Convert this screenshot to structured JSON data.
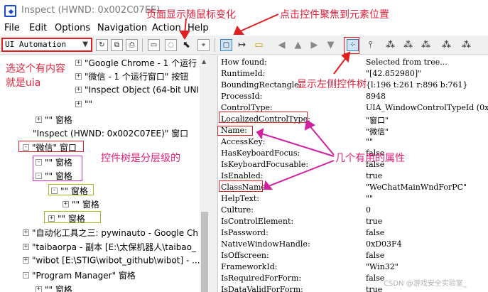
{
  "window": {
    "title": "Inspect  (HWND: 0x002C07EE)"
  },
  "menu": [
    "File",
    "Edit",
    "Options",
    "Navigation",
    "Action",
    "Help"
  ],
  "toolbar": {
    "mode_value": "UI Automation",
    "icons": [
      "refresh-icon",
      "copy-icon",
      "print-icon",
      "highlight-rect-icon",
      "cursor-watch-icon",
      "focus-watch-icon",
      "show-highlight-icon",
      "separator",
      "yellow-rect-icon",
      "nav-left-icon",
      "nav-up-icon",
      "nav-right-icon",
      "nav-down-icon",
      "nav-first-child-icon",
      "tree-view-icon",
      "tree-parent-icon",
      "tree-child-icon",
      "tree-sibling-icon",
      "tree-next-icon",
      "tree-last-icon"
    ]
  },
  "tree": {
    "rows": [
      {
        "label": "\"Google Chrome - 1 个运行",
        "expander": "+"
      },
      {
        "label": "\"微信 - 1 个运行窗口\" 按钮",
        "expander": "+"
      },
      {
        "label": "\"Inspect Object (64-bit UNI",
        "expander": "+"
      },
      {
        "label": "\"\"",
        "expander": "+"
      },
      {
        "label": "\"\" 窗格",
        "expander": "+"
      },
      {
        "label": "\"Inspect  (HWND: 0x002C07EE)\" 窗口",
        "expander": ""
      },
      {
        "label": "\"微信\" 窗口",
        "expander": "-"
      },
      {
        "label": "\"\" 窗格",
        "expander": "-"
      },
      {
        "label": "\"\" 窗格",
        "expander": "-"
      },
      {
        "label": "\"\" 窗格",
        "expander": "-"
      },
      {
        "label": "\"\" 窗格",
        "expander": "+"
      },
      {
        "label": "\"\" 窗格",
        "expander": "+"
      },
      {
        "label": "\"自动化工具之三: pywinauto - Google Ch",
        "expander": "+"
      },
      {
        "label": "\"taibaorpa - 副本 [E:\\太保机器人\\taibao_",
        "expander": "+"
      },
      {
        "label": "\"wibot [E:\\STIG\\wibot_github\\wibot] - ...\\",
        "expander": "+"
      },
      {
        "label": "\"Program Manager\" 窗格",
        "expander": "-"
      },
      {
        "label": "\"\" 窗格",
        "expander": "+"
      }
    ]
  },
  "properties": [
    {
      "name": "How found:",
      "value": "Selected from tree..."
    },
    {
      "name": "RuntimeId:",
      "value": "\"[42.852980]\""
    },
    {
      "name": "BoundingRectangle:",
      "value": "{l:196 t:261 r:896 b:761}"
    },
    {
      "name": "ProcessId:",
      "value": "8948"
    },
    {
      "name": "ControlType:",
      "value": "UIA_WindowControlTypeId (0xC37"
    },
    {
      "name": "LocalizedControlType:",
      "value": "\"窗口\""
    },
    {
      "name": "Name:",
      "value": "\"微信\""
    },
    {
      "name": "AccessKey:",
      "value": "\"\""
    },
    {
      "name": "HasKeyboardFocus:",
      "value": "false"
    },
    {
      "name": "IsKeyboardFocusable:",
      "value": "false"
    },
    {
      "name": "IsEnabled:",
      "value": "true"
    },
    {
      "name": "ClassName:",
      "value": "\"WeChatMainWndForPC\""
    },
    {
      "name": "HelpText:",
      "value": "\"\""
    },
    {
      "name": "Culture:",
      "value": "0"
    },
    {
      "name": "IsControlElement:",
      "value": "true"
    },
    {
      "name": "IsPassword:",
      "value": "false"
    },
    {
      "name": "NativeWindowHandle:",
      "value": "0xD03F4"
    },
    {
      "name": "IsOffscreen:",
      "value": "false"
    },
    {
      "name": "FrameworkId:",
      "value": "\"Win32\""
    },
    {
      "name": "IsRequiredForForm:",
      "value": "false"
    },
    {
      "name": "IsDataValidForForm:",
      "value": "true"
    }
  ],
  "annotations": {
    "uia_note_line1": "选这个有内容",
    "uia_note_line2": "就是uia",
    "hover_note": "页面显示随鼠标变化",
    "focus_note": "点击控件聚焦到元素位置",
    "show_left_note": "显示左侧控件树",
    "tree_note": "控件树是分层级的",
    "props_note": "几个有用的属性"
  },
  "watermark": "CSDN @游戏安全实验室_",
  "colors": {
    "annotation_red": "#e0203a",
    "annotation_pink": "#e0207a",
    "box_magenta": "#c030c0",
    "box_olive": "#a8b820"
  }
}
